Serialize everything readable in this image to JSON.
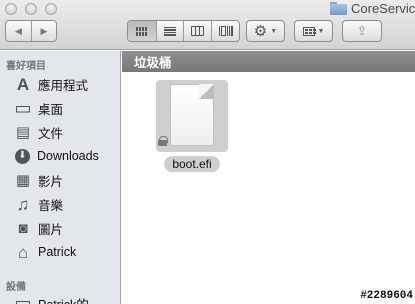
{
  "window": {
    "title": "CoreServic",
    "title_icon": "folder-icon"
  },
  "toolbar": {
    "back_icon": "◀",
    "forward_icon": "▶",
    "view_modes": [
      "icon-view",
      "list-view",
      "column-view",
      "coverflow-view"
    ],
    "action_icon": "⚙",
    "arrange_icon": "arrange",
    "share_icon": "⇪",
    "caret": "▼"
  },
  "sidebar": {
    "favorites_header": "喜好項目",
    "favorites": [
      {
        "label": "應用程式",
        "icon": "applications-icon",
        "glyph": "A"
      },
      {
        "label": "桌面",
        "icon": "desktop-icon",
        "glyph": "▭"
      },
      {
        "label": "文件",
        "icon": "documents-icon",
        "glyph": "▤"
      },
      {
        "label": "Downloads",
        "icon": "downloads-icon",
        "glyph": "⬇"
      },
      {
        "label": "影片",
        "icon": "movies-icon",
        "glyph": "▦"
      },
      {
        "label": "音樂",
        "icon": "music-icon",
        "glyph": "♫"
      },
      {
        "label": "圖片",
        "icon": "pictures-icon",
        "glyph": "◙"
      },
      {
        "label": "Patrick",
        "icon": "home-icon",
        "glyph": "⌂"
      }
    ],
    "devices_header": "設備",
    "devices": [
      {
        "label": "Patrick的",
        "icon": "computer-icon",
        "glyph": "▭"
      }
    ]
  },
  "path_bar": {
    "title": "垃圾桶"
  },
  "files": [
    {
      "name": "boot.efi",
      "icon": "document-icon",
      "locked": true
    }
  ],
  "watermark": "#2289604",
  "colors": {
    "sidebar_bg": "#e3e7ec",
    "path_bar_bg": "#808080",
    "selection_bg": "#cfcfcf"
  }
}
